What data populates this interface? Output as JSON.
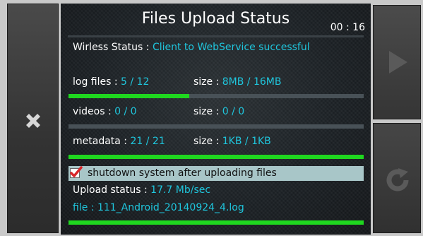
{
  "header": {
    "title": "Files Upload Status",
    "timer": "00 : 16"
  },
  "wireless": {
    "label": "Wirless Status :",
    "value": "Client to WebService successful"
  },
  "log_files": {
    "label": "log files :",
    "value": "5 / 12",
    "size_label": "size :",
    "size_value": "8MB / 16MB",
    "progress": 0.41
  },
  "videos": {
    "label": "videos :",
    "value": "0 / 0",
    "size_label": "size :",
    "size_value": "0 / 0",
    "progress": 0.0
  },
  "metadata": {
    "label": "metadata :",
    "value": "21 / 21",
    "size_label": "size :",
    "size_value": "1KB / 1KB",
    "progress": 1.0
  },
  "shutdown": {
    "label": "shutdown system after uploading files",
    "checked": true
  },
  "upload": {
    "label": "Upload status :",
    "value": "17.7 Mb/sec"
  },
  "file": {
    "label": "file :",
    "value": "111_Android_20140924_4.log",
    "progress": 1.0
  },
  "icons": {
    "cancel": "close-icon",
    "play": "play-icon",
    "refresh": "refresh-icon"
  },
  "colors": {
    "accent": "#1fc6dd",
    "progress": "#1fd71f",
    "checkmark": "#d8262a"
  }
}
